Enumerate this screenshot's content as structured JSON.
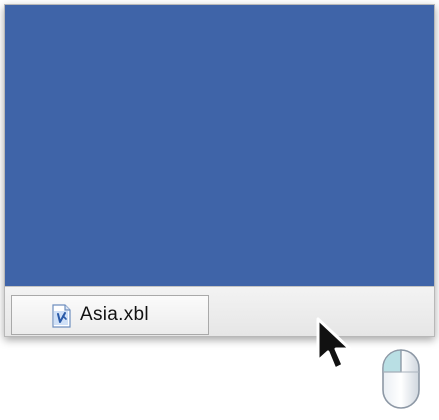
{
  "canvas": {
    "background_color": "#3f64a8"
  },
  "tabs": [
    {
      "label": "Asia.xbl",
      "icon": "xbl-file-icon",
      "selected": true
    }
  ],
  "pointer": {
    "icon": "arrow-cursor-icon"
  },
  "hint": {
    "icon": "mouse-left-click-icon"
  }
}
